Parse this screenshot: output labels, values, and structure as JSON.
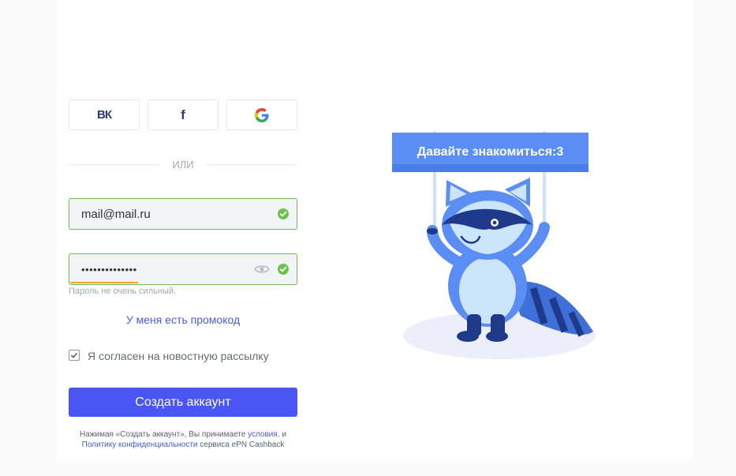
{
  "social": {
    "vk_label": "ВК",
    "facebook_label": "f",
    "google_label": "G",
    "colors": {
      "google_blue": "#4285F4",
      "google_red": "#EA4335",
      "google_yellow": "#FBBC05",
      "google_green": "#34A853"
    }
  },
  "divider": {
    "text": "ИЛИ"
  },
  "email": {
    "value": "mail@mail.ru",
    "valid": true
  },
  "password": {
    "value": "••••••••••••••",
    "valid": true,
    "strength_fraction": 0.3,
    "hint": "Пароль не очень сильный."
  },
  "promo_link": "У меня есть промокод",
  "newsletter": {
    "label": "Я согласен на новостную рассылку",
    "checked": true
  },
  "submit_label": "Создать аккаунт",
  "terms": {
    "prefix": "Нажимая «Создать аккаунт», Вы принимаете ",
    "conditions_link": "условия",
    "middle": ", и",
    "privacy_link": "Политику конфиденциальности",
    "suffix": " сервиса ePN Cashback"
  },
  "illustration": {
    "banner_text": "Давайте знакомиться:3",
    "mascot": "raccoon"
  },
  "colors": {
    "accent": "#4a55f5",
    "valid": "#6cc24a",
    "link": "#4a5bd6",
    "banner": "#5b8ef5"
  }
}
